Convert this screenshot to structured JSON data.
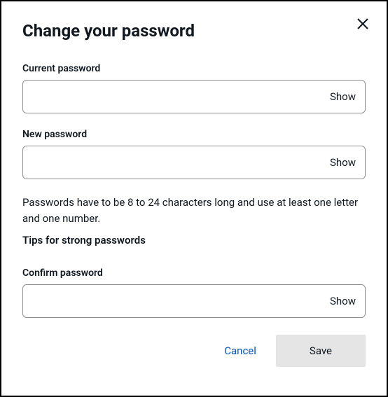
{
  "dialog": {
    "title": "Change your password",
    "close_label": "Close"
  },
  "fields": {
    "current": {
      "label": "Current password",
      "value": "",
      "show_label": "Show"
    },
    "new": {
      "label": "New password",
      "value": "",
      "show_label": "Show"
    },
    "confirm": {
      "label": "Confirm password",
      "value": "",
      "show_label": "Show"
    }
  },
  "helper": {
    "text": "Passwords have to be 8 to 24 characters long and use at least one letter and one number.",
    "tips_link": "Tips for strong passwords"
  },
  "actions": {
    "cancel": "Cancel",
    "save": "Save"
  }
}
